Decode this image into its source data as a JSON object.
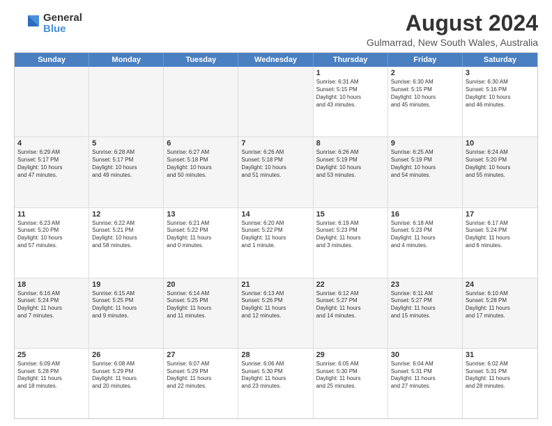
{
  "logo": {
    "general": "General",
    "blue": "Blue"
  },
  "title": "August 2024",
  "subtitle": "Gulmarrad, New South Wales, Australia",
  "header_days": [
    "Sunday",
    "Monday",
    "Tuesday",
    "Wednesday",
    "Thursday",
    "Friday",
    "Saturday"
  ],
  "weeks": [
    [
      {
        "day": "",
        "text": ""
      },
      {
        "day": "",
        "text": ""
      },
      {
        "day": "",
        "text": ""
      },
      {
        "day": "",
        "text": ""
      },
      {
        "day": "1",
        "text": "Sunrise: 6:31 AM\nSunset: 5:15 PM\nDaylight: 10 hours\nand 43 minutes."
      },
      {
        "day": "2",
        "text": "Sunrise: 6:30 AM\nSunset: 5:15 PM\nDaylight: 10 hours\nand 45 minutes."
      },
      {
        "day": "3",
        "text": "Sunrise: 6:30 AM\nSunset: 5:16 PM\nDaylight: 10 hours\nand 46 minutes."
      }
    ],
    [
      {
        "day": "4",
        "text": "Sunrise: 6:29 AM\nSunset: 5:17 PM\nDaylight: 10 hours\nand 47 minutes."
      },
      {
        "day": "5",
        "text": "Sunrise: 6:28 AM\nSunset: 5:17 PM\nDaylight: 10 hours\nand 49 minutes."
      },
      {
        "day": "6",
        "text": "Sunrise: 6:27 AM\nSunset: 5:18 PM\nDaylight: 10 hours\nand 50 minutes."
      },
      {
        "day": "7",
        "text": "Sunrise: 6:26 AM\nSunset: 5:18 PM\nDaylight: 10 hours\nand 51 minutes."
      },
      {
        "day": "8",
        "text": "Sunrise: 6:26 AM\nSunset: 5:19 PM\nDaylight: 10 hours\nand 53 minutes."
      },
      {
        "day": "9",
        "text": "Sunrise: 6:25 AM\nSunset: 5:19 PM\nDaylight: 10 hours\nand 54 minutes."
      },
      {
        "day": "10",
        "text": "Sunrise: 6:24 AM\nSunset: 5:20 PM\nDaylight: 10 hours\nand 55 minutes."
      }
    ],
    [
      {
        "day": "11",
        "text": "Sunrise: 6:23 AM\nSunset: 5:20 PM\nDaylight: 10 hours\nand 57 minutes."
      },
      {
        "day": "12",
        "text": "Sunrise: 6:22 AM\nSunset: 5:21 PM\nDaylight: 10 hours\nand 58 minutes."
      },
      {
        "day": "13",
        "text": "Sunrise: 6:21 AM\nSunset: 5:22 PM\nDaylight: 11 hours\nand 0 minutes."
      },
      {
        "day": "14",
        "text": "Sunrise: 6:20 AM\nSunset: 5:22 PM\nDaylight: 11 hours\nand 1 minute."
      },
      {
        "day": "15",
        "text": "Sunrise: 6:19 AM\nSunset: 5:23 PM\nDaylight: 11 hours\nand 3 minutes."
      },
      {
        "day": "16",
        "text": "Sunrise: 6:18 AM\nSunset: 5:23 PM\nDaylight: 11 hours\nand 4 minutes."
      },
      {
        "day": "17",
        "text": "Sunrise: 6:17 AM\nSunset: 5:24 PM\nDaylight: 11 hours\nand 6 minutes."
      }
    ],
    [
      {
        "day": "18",
        "text": "Sunrise: 6:16 AM\nSunset: 5:24 PM\nDaylight: 11 hours\nand 7 minutes."
      },
      {
        "day": "19",
        "text": "Sunrise: 6:15 AM\nSunset: 5:25 PM\nDaylight: 11 hours\nand 9 minutes."
      },
      {
        "day": "20",
        "text": "Sunrise: 6:14 AM\nSunset: 5:25 PM\nDaylight: 11 hours\nand 11 minutes."
      },
      {
        "day": "21",
        "text": "Sunrise: 6:13 AM\nSunset: 5:26 PM\nDaylight: 11 hours\nand 12 minutes."
      },
      {
        "day": "22",
        "text": "Sunrise: 6:12 AM\nSunset: 5:27 PM\nDaylight: 11 hours\nand 14 minutes."
      },
      {
        "day": "23",
        "text": "Sunrise: 6:11 AM\nSunset: 5:27 PM\nDaylight: 11 hours\nand 15 minutes."
      },
      {
        "day": "24",
        "text": "Sunrise: 6:10 AM\nSunset: 5:28 PM\nDaylight: 11 hours\nand 17 minutes."
      }
    ],
    [
      {
        "day": "25",
        "text": "Sunrise: 6:09 AM\nSunset: 5:28 PM\nDaylight: 11 hours\nand 18 minutes."
      },
      {
        "day": "26",
        "text": "Sunrise: 6:08 AM\nSunset: 5:29 PM\nDaylight: 11 hours\nand 20 minutes."
      },
      {
        "day": "27",
        "text": "Sunrise: 6:07 AM\nSunset: 5:29 PM\nDaylight: 11 hours\nand 22 minutes."
      },
      {
        "day": "28",
        "text": "Sunrise: 6:06 AM\nSunset: 5:30 PM\nDaylight: 11 hours\nand 23 minutes."
      },
      {
        "day": "29",
        "text": "Sunrise: 6:05 AM\nSunset: 5:30 PM\nDaylight: 11 hours\nand 25 minutes."
      },
      {
        "day": "30",
        "text": "Sunrise: 6:04 AM\nSunset: 5:31 PM\nDaylight: 11 hours\nand 27 minutes."
      },
      {
        "day": "31",
        "text": "Sunrise: 6:02 AM\nSunset: 5:31 PM\nDaylight: 11 hours\nand 28 minutes."
      }
    ]
  ]
}
